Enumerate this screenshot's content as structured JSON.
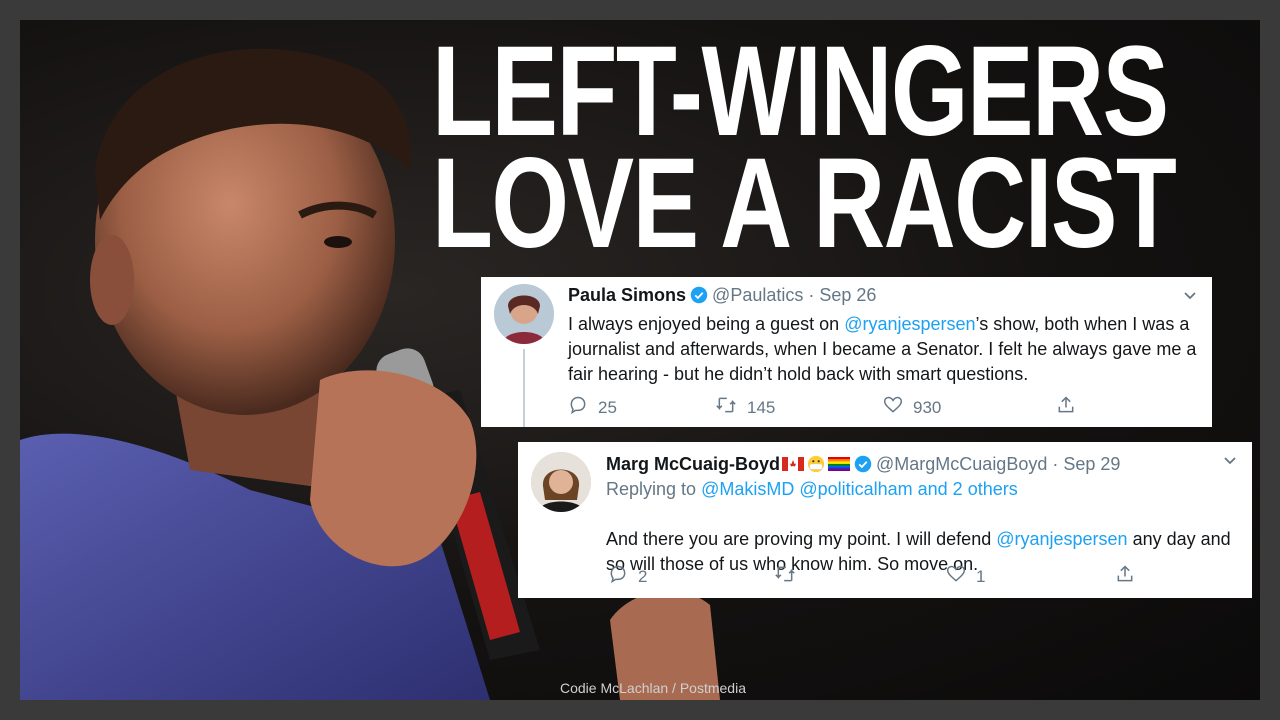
{
  "headline": {
    "line1": "LEFT-WINGERS",
    "line2": "LOVE A RACIST"
  },
  "photo_credit": "Codie McLachlan / Postmedia",
  "tweets": [
    {
      "name": "Paula Simons",
      "handle": "@Paulatics",
      "sep": "·",
      "date": "Sep 26",
      "body_pre": "I always enjoyed being a guest on ",
      "body_mention": "@ryanjespersen",
      "body_post": "’s show, both when I was a journalist and afterwards, when I became a Senator. I felt he always gave me a fair hearing - but he didn’t hold back with smart questions.",
      "replies": "25",
      "retweets": "145",
      "likes": "930"
    },
    {
      "name": "Marg McCuaig-Boyd",
      "handle": "@MargMcCuaigBoyd",
      "sep": "·",
      "date": "Sep 29",
      "replying_label": "Replying to ",
      "replying_targets": "@MakisMD @politicalham and 2 others",
      "body_pre": "And there you are proving my point.  I will defend ",
      "body_mention": "@ryanjespersen",
      "body_post": " any day and so will those of us who know him.  So move on.",
      "replies": "2",
      "retweets": "",
      "likes": "1"
    }
  ],
  "colors": {
    "link": "#1da1f2",
    "muted": "#657786",
    "verified": "#1da1f2"
  },
  "icons": [
    "verified-icon",
    "chevron-down-icon",
    "reply-icon",
    "retweet-icon",
    "like-icon",
    "share-icon"
  ]
}
